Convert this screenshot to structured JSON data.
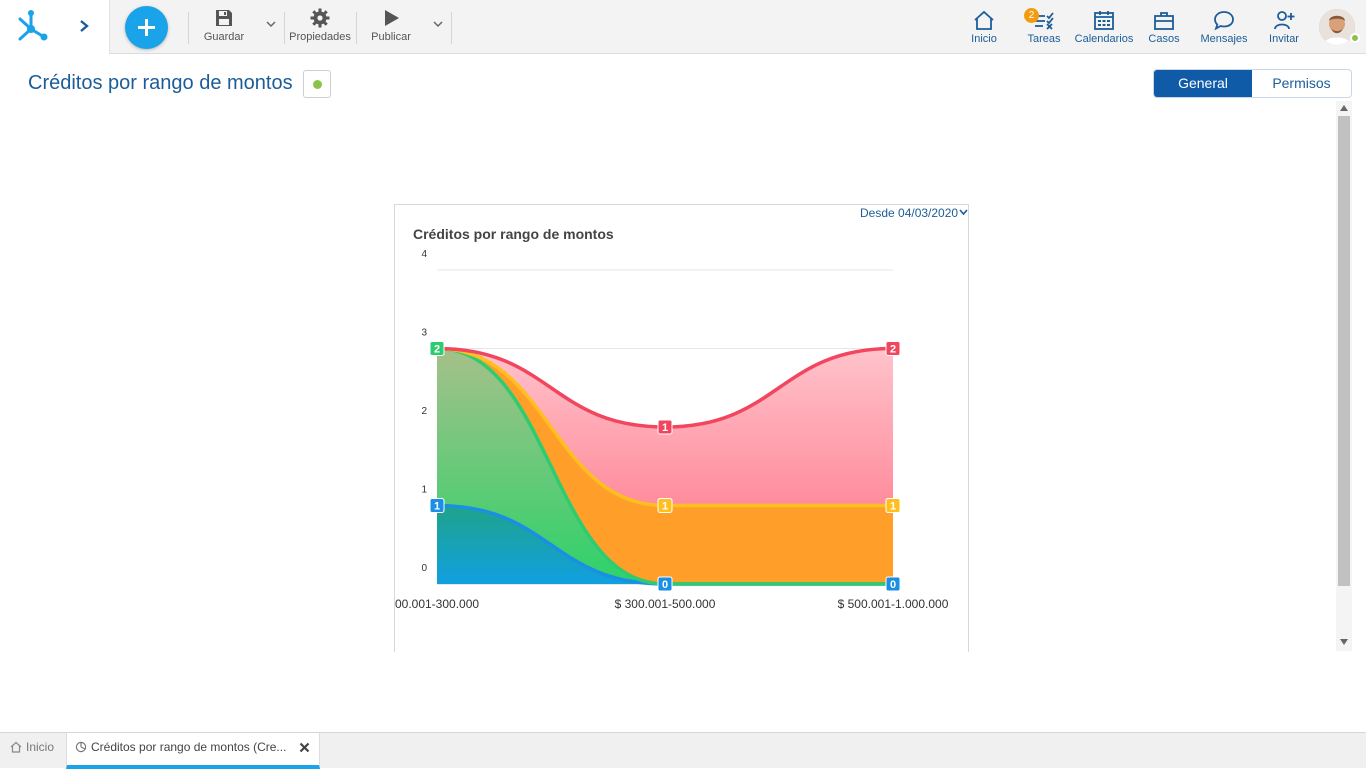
{
  "toolbar": {
    "save_label": "Guardar",
    "properties_label": "Propiedades",
    "publish_label": "Publicar"
  },
  "nav": {
    "home_label": "Inicio",
    "tasks_label": "Tareas",
    "tasks_badge": "2",
    "calendars_label": "Calendarios",
    "cases_label": "Casos",
    "messages_label": "Mensajes",
    "invite_label": "Invitar"
  },
  "header": {
    "title": "Créditos por rango de montos",
    "status_color": "#8bc34a"
  },
  "tabs": {
    "general": "General",
    "permissions": "Permisos"
  },
  "chart_card": {
    "date_filter": "Desde 04/03/2020"
  },
  "chart_data": {
    "type": "area",
    "stacked": true,
    "title": "Créditos por rango de montos",
    "categories": [
      "00.001-300.000",
      "$ 300.001-500.000",
      "$ 500.001-1.000.000"
    ],
    "ylim": [
      0,
      4
    ],
    "yticks": [
      "0",
      "1",
      "2",
      "3",
      "4"
    ],
    "grid": true,
    "series": [
      {
        "values": [
          1,
          0,
          0
        ],
        "color": "#1a8fe3",
        "fill_top": "#1fa38a",
        "fill_bottom": "#10a0e0"
      },
      {
        "values": [
          2,
          0,
          0
        ],
        "color": "#2ecc71",
        "fill_top": "#a6c08a",
        "fill_bottom": "#2dd26a"
      },
      {
        "values": [
          0,
          1,
          1
        ],
        "color": "#ffbf1f",
        "fill_top": "#ff9f2a",
        "fill_bottom": "#ff9f2a"
      },
      {
        "values": [
          0,
          1,
          2
        ],
        "color": "#f2465f",
        "fill_top": "#ffc3cb",
        "fill_bottom": "#ff8c9c"
      }
    ],
    "data_labels": [
      {
        "category": 0,
        "top": 1,
        "text": "1",
        "color": "#1a8fe3"
      },
      {
        "category": 0,
        "top": 3,
        "text": "2",
        "color": "#2ecc71"
      },
      {
        "category": 1,
        "top": 0,
        "text": "0",
        "color": "#1a8fe3"
      },
      {
        "category": 1,
        "top": 1,
        "text": "1",
        "color": "#ffbf1f"
      },
      {
        "category": 1,
        "top": 2,
        "text": "1",
        "color": "#f2465f"
      },
      {
        "category": 2,
        "top": 0,
        "text": "0",
        "color": "#1a8fe3"
      },
      {
        "category": 2,
        "top": 1,
        "text": "1",
        "color": "#ffbf1f"
      },
      {
        "category": 2,
        "top": 3,
        "text": "2",
        "color": "#f2465f"
      }
    ]
  },
  "bottom_tabs": {
    "home_label": "Inicio",
    "active_label": "Créditos por rango de montos (Cre..."
  }
}
